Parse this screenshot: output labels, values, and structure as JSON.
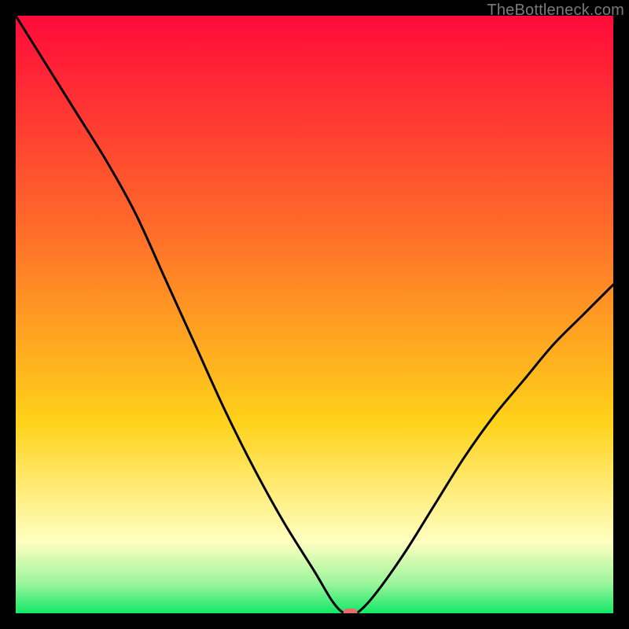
{
  "watermark": "TheBottleneck.com",
  "colors": {
    "top": "#ff0a3a",
    "mid1": "#ff6a2a",
    "mid2": "#ffd21a",
    "pale": "#ffffc0",
    "green_light": "#9cf59c",
    "green": "#12e866",
    "frame": "#000000",
    "curve": "#000000",
    "marker": "#e86b6b"
  },
  "chart_data": {
    "type": "line",
    "title": "",
    "xlabel": "",
    "ylabel": "",
    "xlim": [
      0,
      100
    ],
    "ylim": [
      0,
      100
    ],
    "x": [
      0,
      5,
      10,
      15,
      20,
      25,
      30,
      35,
      40,
      45,
      50,
      53,
      55,
      57,
      60,
      65,
      70,
      75,
      80,
      85,
      90,
      95,
      100
    ],
    "values": [
      100,
      92,
      84,
      76,
      67,
      56,
      45,
      34,
      24,
      15,
      7,
      2,
      0,
      0,
      3,
      10,
      18,
      26,
      33,
      39,
      45,
      50,
      55
    ],
    "marker": {
      "x": 56,
      "y": 0
    }
  }
}
